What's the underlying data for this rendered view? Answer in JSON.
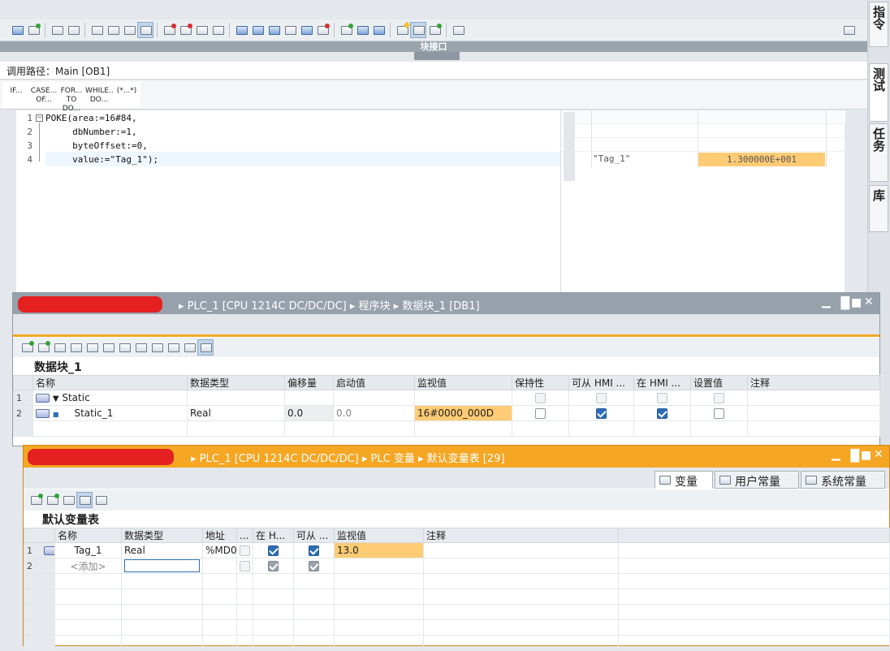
{
  "editor": {
    "interface_label": "块接口",
    "call_path": "调用路径：Main [OB1]",
    "templates": [
      {
        "line1": "IF...",
        "line2": ""
      },
      {
        "line1": "CASE...",
        "line2": "OF..."
      },
      {
        "line1": "FOR...",
        "line2": "TO DO..."
      },
      {
        "line1": "WHILE..",
        "line2": "DO..."
      },
      {
        "line1": "(*...*)",
        "line2": ""
      }
    ],
    "code_lines": [
      {
        "num": "1",
        "text": "POKE(area:=16#84,"
      },
      {
        "num": "2",
        "text": "     dbNumber:=1,"
      },
      {
        "num": "3",
        "text": "     byteOffset:=0,"
      },
      {
        "num": "4",
        "text": "     value:=\"Tag_1\");"
      }
    ],
    "watch": {
      "tag": "\"Tag_1\"",
      "value": "1.300000E+001"
    }
  },
  "task_tabs": [
    "指令",
    "测试",
    "任务",
    "库"
  ],
  "db_window": {
    "breadcrumb": "▸ PLC_1 [CPU 1214C DC/DC/DC]  ▸ 程序块  ▸ 数据块_1 [DB1]",
    "block_name": "数据块_1",
    "columns": [
      "",
      "名称",
      "数据类型",
      "偏移量",
      "启动值",
      "监视值",
      "保持性",
      "可从 HMI ...",
      "在 HMI ...",
      "设置值",
      "注释"
    ],
    "rows": [
      {
        "no": "1",
        "name": "Static",
        "type": "",
        "offset": "",
        "start": "",
        "monitor": ""
      },
      {
        "no": "2",
        "name": "Static_1",
        "type": "Real",
        "offset": "0.0",
        "start": "0.0",
        "monitor": "16#0000_000D"
      }
    ]
  },
  "tag_window": {
    "breadcrumb": "▸ PLC_1 [CPU 1214C DC/DC/DC]  ▸ PLC 变量  ▸ 默认变量表 [29]",
    "tabs": [
      "变量",
      "用户常量",
      "系统常量"
    ],
    "table_name": "默认变量表",
    "columns": [
      "",
      "名称",
      "数据类型",
      "地址",
      "...",
      "在 H...",
      "可从 ...",
      "监视值",
      "注释"
    ],
    "rows": [
      {
        "no": "1",
        "name": "Tag_1",
        "type": "Real",
        "address": "%MD0",
        "monitor": "13.0"
      },
      {
        "no": "2",
        "name": "<添加>",
        "type": "",
        "address": "",
        "monitor": ""
      }
    ]
  }
}
